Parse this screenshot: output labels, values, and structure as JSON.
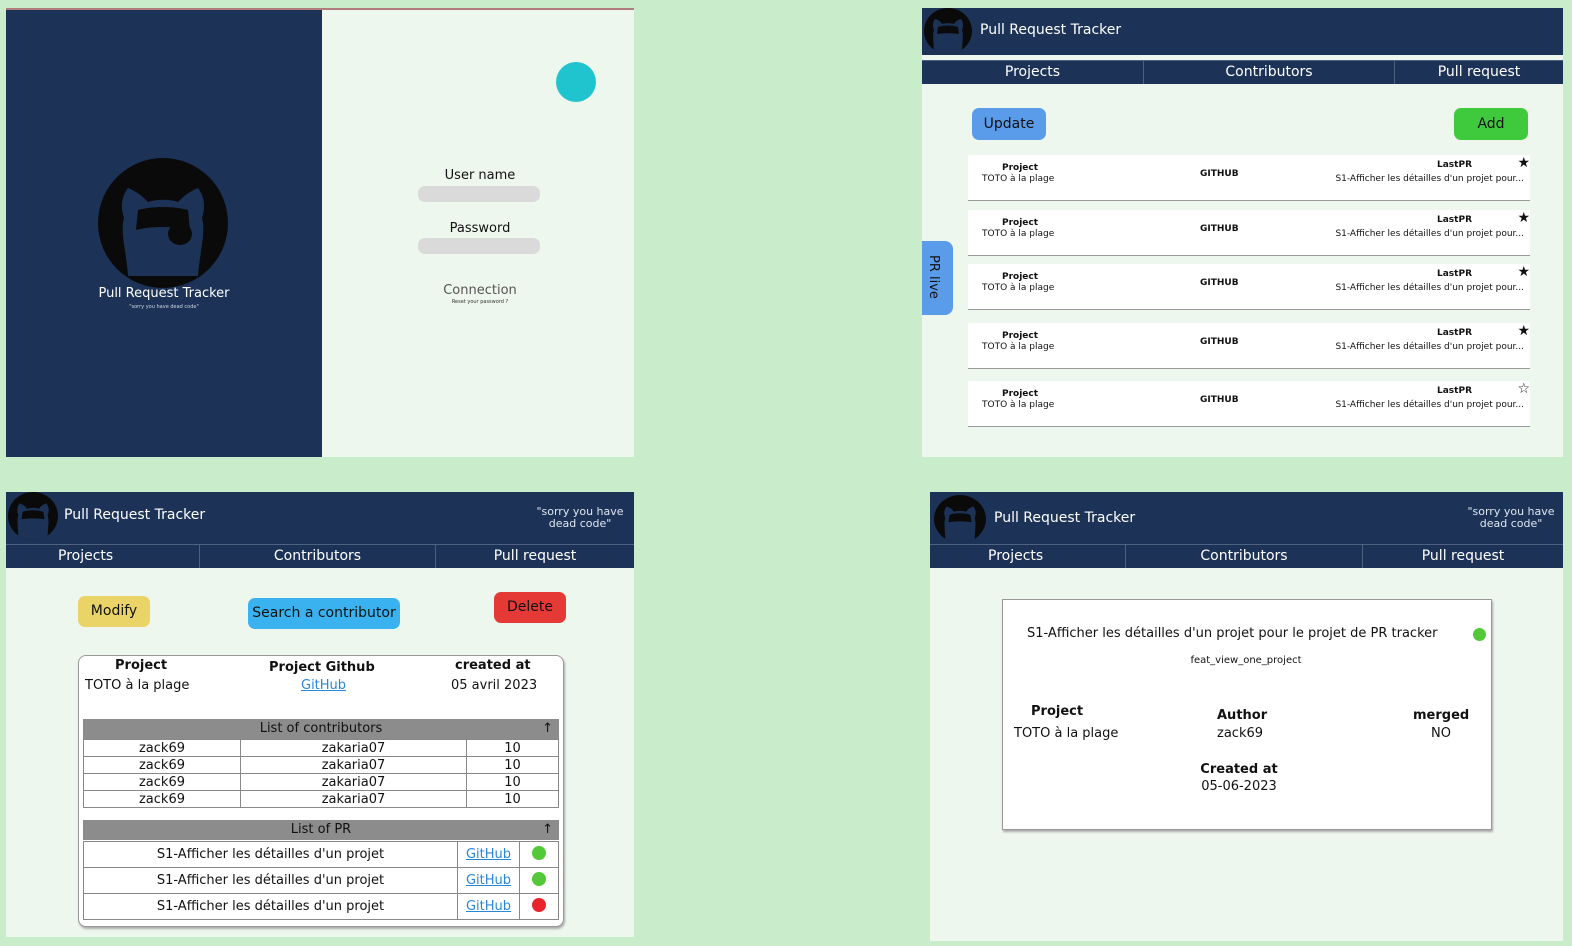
{
  "app": {
    "title": "Pull Request Tracker",
    "tagline": "\"sorry you have dead code\"",
    "tagline_small": "\"sorry you have dead code\""
  },
  "nav": {
    "projects": "Projects",
    "contributors": "Contributors",
    "pull_request": "Pull request"
  },
  "login": {
    "username_label": "User name",
    "password_label": "Password",
    "connection_label": "Connection",
    "reset_label": "Reset your password ?",
    "accent": "#20c4cf"
  },
  "projects_view": {
    "update_label": "Update",
    "add_label": "Add",
    "pr_live_label": "PR live",
    "rows": [
      {
        "project_label": "Project",
        "project": "TOTO à la plage",
        "github": "GITHUB",
        "lastpr_label": "LastPR",
        "lastpr": "S1-Afficher les détailles d'un projet pour...",
        "starred": "★"
      },
      {
        "project_label": "Project",
        "project": "TOTO à la plage",
        "github": "GITHUB",
        "lastpr_label": "LastPR",
        "lastpr": "S1-Afficher les détailles d'un projet pour...",
        "starred": "★"
      },
      {
        "project_label": "Project",
        "project": "TOTO à la plage",
        "github": "GITHUB",
        "lastpr_label": "LastPR",
        "lastpr": "S1-Afficher les détailles d'un projet pour...",
        "starred": "★"
      },
      {
        "project_label": "Project",
        "project": "TOTO à la plage",
        "github": "GITHUB",
        "lastpr_label": "LastPR",
        "lastpr": "S1-Afficher les détailles d'un projet pour...",
        "starred": "★"
      },
      {
        "project_label": "Project",
        "project": "TOTO à la plage",
        "github": "GITHUB",
        "lastpr_label": "LastPR",
        "lastpr": "S1-Afficher les détailles d'un projet pour...",
        "starred": "☆"
      }
    ]
  },
  "project_detail": {
    "modify_label": "Modify",
    "search_label": "Search a contributor",
    "delete_label": "Delete",
    "project_label": "Project",
    "project_value": "TOTO à la plage",
    "github_label": "Project Github",
    "github_link": "GitHub",
    "created_label": "created at",
    "created_value": "05 avril 2023",
    "contributors_title": "List of contributors",
    "contributors_arrow": "↑",
    "contributors": [
      {
        "name": "zack69",
        "login": "zakaria07",
        "count": "10"
      },
      {
        "name": "zack69",
        "login": "zakaria07",
        "count": "10"
      },
      {
        "name": "zack69",
        "login": "zakaria07",
        "count": "10"
      },
      {
        "name": "zack69",
        "login": "zakaria07",
        "count": "10"
      }
    ],
    "pr_title": "List of PR",
    "pr_arrow": "↑",
    "prs": [
      {
        "title": "S1-Afficher les détailles d'un projet",
        "link": "GitHub",
        "status_color": "#53c93a"
      },
      {
        "title": "S1-Afficher les détailles d'un projet",
        "link": "GitHub",
        "status_color": "#53c93a"
      },
      {
        "title": "S1-Afficher les détailles d'un projet",
        "link": "GitHub",
        "status_color": "#e8232a"
      }
    ]
  },
  "pr_detail": {
    "title": "S1-Afficher les détailles d'un projet pour le projet de PR tracker",
    "branch": "feat_view_one_project",
    "project_label": "Project",
    "project_value": "TOTO à la plage",
    "author_label": "Author",
    "author_value": "zack69",
    "merged_label": "merged",
    "merged_value": "NO",
    "created_label": "Created at",
    "created_value": "05-06-2023",
    "status_color": "#53c93a"
  },
  "colors": {
    "navy": "#1c3357",
    "blue_button": "#5b9cea",
    "green_button": "#3fca3d",
    "yellow_button": "#ead468",
    "cyan_button": "#3ab2f0",
    "red_button": "#e53935"
  }
}
